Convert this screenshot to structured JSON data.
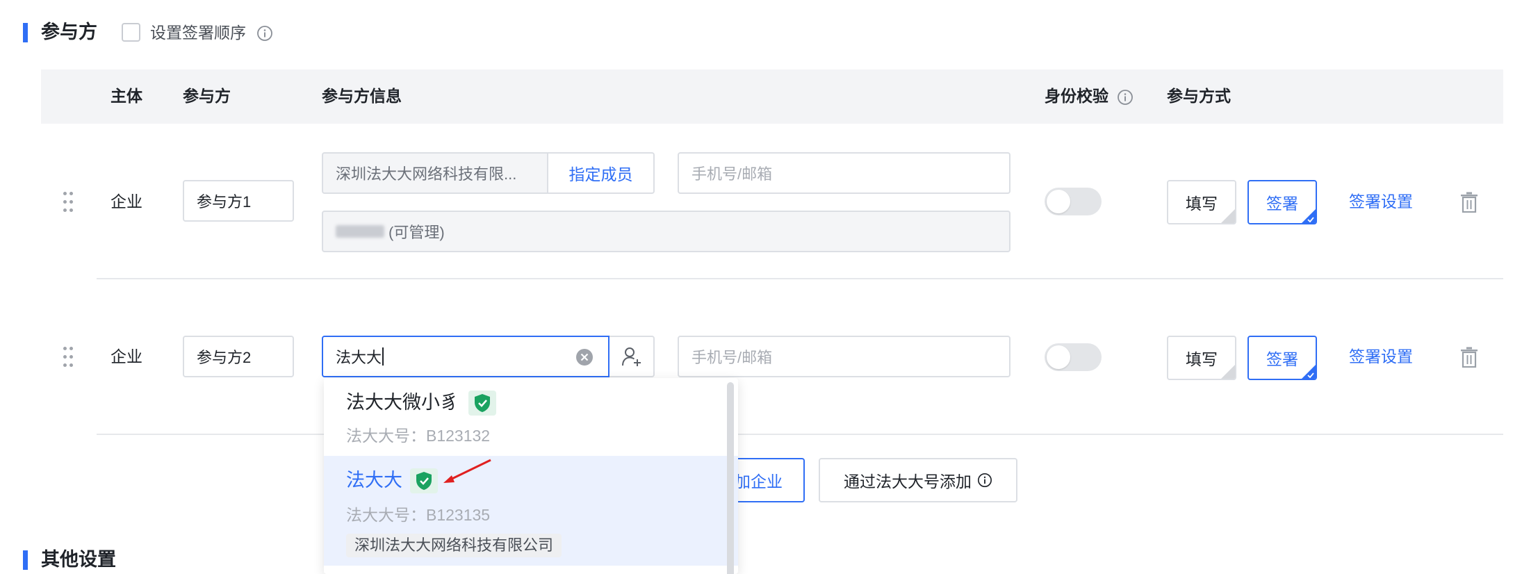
{
  "section_participants": {
    "title": "参与方",
    "order_checkbox_label": "设置签署顺序",
    "order_checkbox_checked": false
  },
  "table_headers": {
    "subject": "主体",
    "party": "参与方",
    "party_info": "参与方信息",
    "identity_check": "身份校验",
    "participation_mode": "参与方式"
  },
  "rows": [
    {
      "subject": "企业",
      "party_name": "参与方1",
      "company_value": "深圳法大大网络科技有限...",
      "assign_member_label": "指定成员",
      "contact_placeholder": "手机号/邮箱",
      "member_value": "(可管理)",
      "identity_check_on": false,
      "fill_label": "填写",
      "sign_label": "签署",
      "sign_settings_label": "签署设置"
    },
    {
      "subject": "企业",
      "party_name": "参与方2",
      "search_value": "法大大",
      "contact_placeholder": "手机号/邮箱",
      "identity_check_on": false,
      "fill_label": "填写",
      "sign_label": "签署",
      "sign_settings_label": "签署设置"
    }
  ],
  "dropdown": {
    "items": [
      {
        "name": "法大大微小豸",
        "account": "法大大号：B123132",
        "verified": true,
        "selected": false
      },
      {
        "name": "法大大",
        "account": "法大大号：B123135",
        "company": "深圳法大大网络科技有限公司",
        "verified": true,
        "selected": true
      }
    ]
  },
  "add_buttons": {
    "add_company_partial": "加企业",
    "add_by_id": "通过法大大号添加"
  },
  "section_other": {
    "title": "其他设置"
  },
  "colors": {
    "accent": "#2f6ef5",
    "verified_green": "#1aa260",
    "arrow_red": "#e02020"
  }
}
